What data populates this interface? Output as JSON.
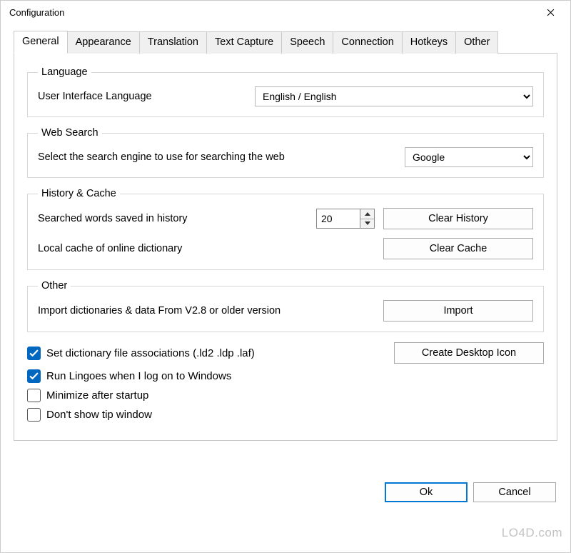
{
  "window": {
    "title": "Configuration"
  },
  "tabs": {
    "general": "General",
    "appearance": "Appearance",
    "translation": "Translation",
    "text_capture": "Text Capture",
    "speech": "Speech",
    "connection": "Connection",
    "hotkeys": "Hotkeys",
    "other": "Other"
  },
  "groups": {
    "language": {
      "legend": "Language",
      "ui_lang_label": "User Interface Language",
      "ui_lang_value": "English  /  English"
    },
    "web_search": {
      "legend": "Web Search",
      "engine_label": "Select the search engine to use for searching the web",
      "engine_value": "Google"
    },
    "history": {
      "legend": "History & Cache",
      "history_label": "Searched words saved in history",
      "history_value": "20",
      "clear_history_btn": "Clear History",
      "cache_label": "Local cache of online dictionary",
      "clear_cache_btn": "Clear Cache"
    },
    "other": {
      "legend": "Other",
      "import_label": "Import dictionaries & data From V2.8 or older version",
      "import_btn": "Import"
    }
  },
  "checks": {
    "file_assoc": "Set dictionary file associations (.ld2 .ldp .laf)",
    "create_desktop_btn": "Create Desktop Icon",
    "run_on_logon": "Run Lingoes when I log on to Windows",
    "minimize": "Minimize after startup",
    "no_tip": "Don't show tip window"
  },
  "buttons": {
    "ok": "Ok",
    "cancel": "Cancel"
  },
  "watermark": "LO4D.com"
}
